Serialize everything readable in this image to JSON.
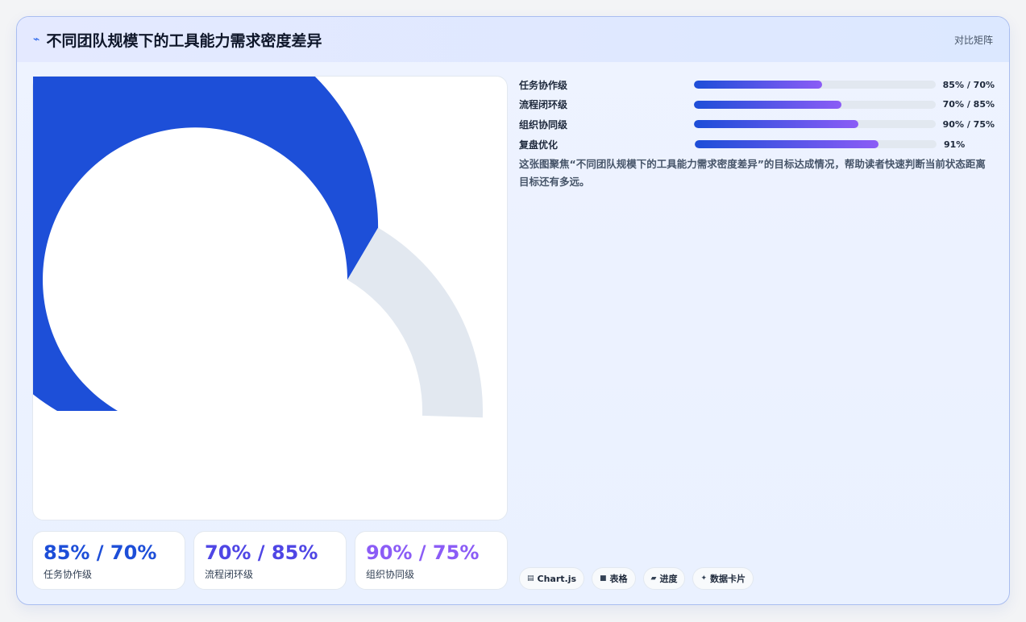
{
  "header": {
    "icon": "⌁",
    "title": "不同团队规模下的工具能力需求密度差异",
    "tag": "对比矩阵"
  },
  "chart_data": {
    "type": "gauge",
    "value": 85,
    "max": 100,
    "colors": {
      "filled": "#1d4fd8",
      "track": "#e2e8f0"
    }
  },
  "stats": [
    {
      "value": "85% / 70%",
      "label": "任务协作级",
      "color": "#1d4ed8"
    },
    {
      "value": "70% / 85%",
      "label": "流程闭环级",
      "color": "#4f46e5"
    },
    {
      "value": "90% / 75%",
      "label": "组织协同级",
      "color": "#8b5cf6"
    }
  ],
  "progress": [
    {
      "name": "任务协作级",
      "fill": 0.53,
      "text": "85% / 70%"
    },
    {
      "name": "流程闭环级",
      "fill": 0.61,
      "text": "70% / 85%"
    },
    {
      "name": "组织协同级",
      "fill": 0.68,
      "text": "90% / 75%"
    },
    {
      "name": "复盘优化",
      "fill": 0.76,
      "text": "91%"
    }
  ],
  "description": "这张图聚焦“不同团队规模下的工具能力需求密度差异”的目标达成情况，帮助读者快速判断当前状态距离目标还有多远。",
  "chips": [
    {
      "icon": "▤",
      "icon_name": "code-icon",
      "label": "Chart.js"
    },
    {
      "icon": "■",
      "icon_name": "table-icon",
      "label": "表格"
    },
    {
      "icon": "▰",
      "icon_name": "progress-icon",
      "label": "进度"
    },
    {
      "icon": "✦",
      "icon_name": "sparkle-icon",
      "label": "数据卡片"
    }
  ]
}
